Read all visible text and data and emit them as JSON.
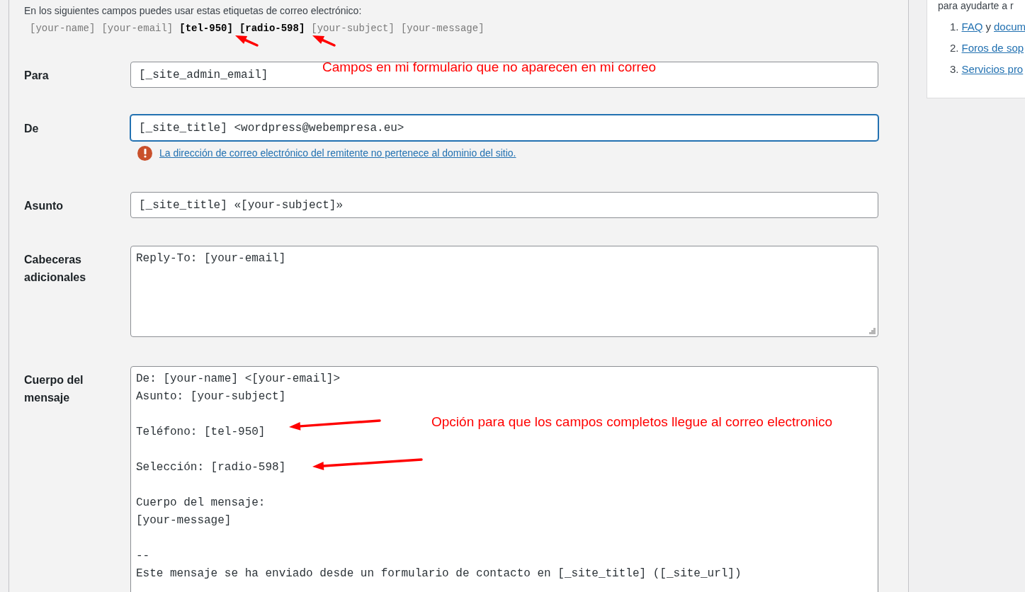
{
  "tags_intro": "En los siguientes campos puedes usar estas etiquetas de correo electrónico:",
  "tags": [
    {
      "text": "[your-name]",
      "bold": false
    },
    {
      "text": "[your-email]",
      "bold": false
    },
    {
      "text": "[tel-950]",
      "bold": true
    },
    {
      "text": "[radio-598]",
      "bold": true
    },
    {
      "text": "[your-subject]",
      "bold": false
    },
    {
      "text": "[your-message]",
      "bold": false
    }
  ],
  "fields": [
    {
      "kind": "input",
      "label": "Para",
      "value": "[_site_admin_email]",
      "focused": false
    },
    {
      "kind": "input",
      "label": "De",
      "value": "[_site_title] <wordpress@webempresa.eu>",
      "focused": true,
      "warning": "La dirección de correo electrónico del remitente no pertenece al dominio del sitio."
    },
    {
      "kind": "input",
      "label": "Asunto",
      "value": "[_site_title] «[your-subject]»",
      "focused": false
    },
    {
      "kind": "textarea",
      "label": "Cabeceras adicionales",
      "paragraphs": [
        [
          "Reply-To: [your-email]"
        ]
      ]
    },
    {
      "kind": "body",
      "label": "Cuerpo del mensaje",
      "paragraphs": [
        [
          "De: [your-name] <[your-email]>",
          "Asunto: [your-subject]"
        ],
        [
          "Teléfono: [tel-950]"
        ],
        [
          "Selección: [radio-598]"
        ],
        [
          "Cuerpo del mensaje:",
          "[your-message]"
        ],
        [
          "--",
          "Este mensaje se ha enviado desde un formulario de contacto en [_site_title] ([_site_url])"
        ]
      ]
    }
  ],
  "annotations": [
    {
      "text": "Campos en mi formulario que no aparecen en mi correo"
    },
    {
      "text": "Opción para que los campos completos llegue al correo electronico"
    }
  ],
  "sidebar": {
    "intro": "para ayudarte a r",
    "items": [
      {
        "number": "1.",
        "links": [
          "FAQ",
          "docum"
        ],
        "joiner": "y"
      },
      {
        "number": "2.",
        "links": [
          "Foros de sop"
        ]
      },
      {
        "number": "3.",
        "links": [
          "Servicios pro"
        ]
      }
    ]
  }
}
